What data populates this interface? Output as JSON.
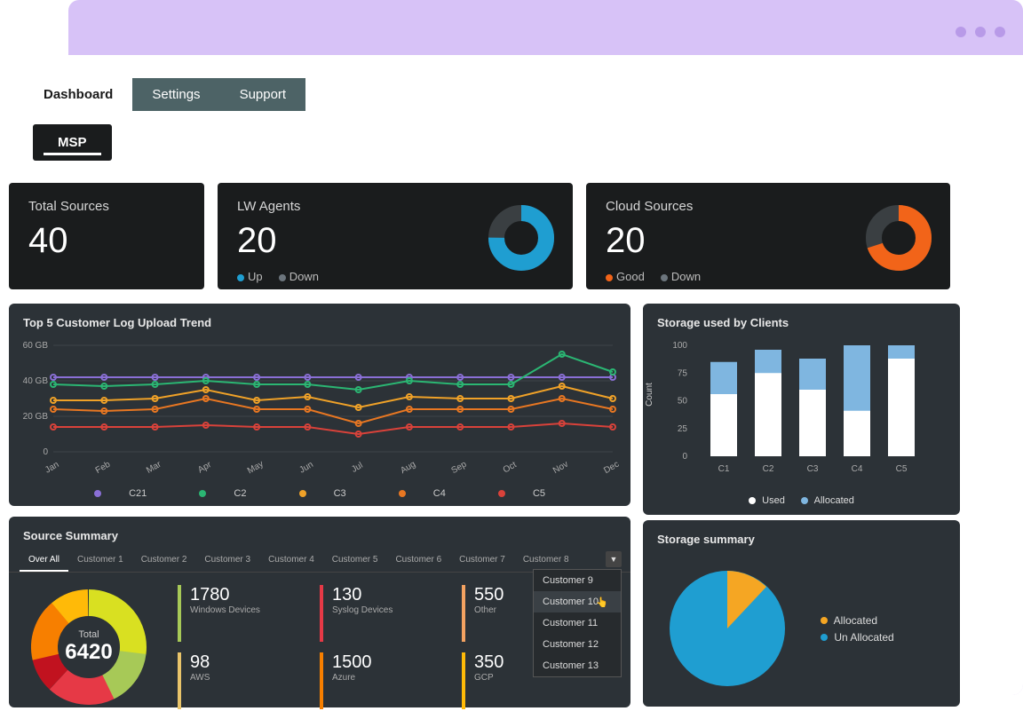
{
  "tabs": {
    "dashboard": "Dashboard",
    "settings": "Settings",
    "support": "Support"
  },
  "sub_tab": "MSP",
  "cards": {
    "total": {
      "title": "Total Sources",
      "value": "40"
    },
    "lw": {
      "title": "LW Agents",
      "value": "20",
      "legend_up": "Up",
      "legend_down": "Down"
    },
    "cloud": {
      "title": "Cloud Sources",
      "value": "20",
      "legend_good": "Good",
      "legend_down": "Down"
    }
  },
  "trend": {
    "title": "Top 5 Customer Log Upload Trend",
    "legend": [
      "C21",
      "C2",
      "C3",
      "C4",
      "C5"
    ]
  },
  "storage_clients": {
    "title": "Storage used by Clients",
    "ylabel": "Count",
    "legend_used": "Used",
    "legend_alloc": "Allocated"
  },
  "summary": {
    "title": "Source Summary",
    "tabs": [
      "Over All",
      "Customer 1",
      "Customer 2",
      "Customer 3",
      "Customer 4",
      "Customer 5",
      "Customer 6",
      "Customer 7",
      "Customer 8"
    ],
    "dropdown": [
      "Customer 9",
      "Customer 10",
      "Customer 11",
      "Customer 12",
      "Customer 13"
    ],
    "total_label": "Total",
    "total_value": "6420",
    "stats": [
      {
        "value": "1780",
        "label": "Windows Devices",
        "color": "#a7c957"
      },
      {
        "value": "130",
        "label": "Syslog Devices",
        "color": "#e63946"
      },
      {
        "value": "550",
        "label": "Other",
        "color": "#f4a261"
      },
      {
        "value": "98",
        "label": "AWS",
        "color": "#e9c46a"
      },
      {
        "value": "1500",
        "label": "Azure",
        "color": "#f77f00"
      },
      {
        "value": "350",
        "label": "GCP",
        "color": "#ffba08"
      }
    ]
  },
  "storage_summary": {
    "title": "Storage summary",
    "legend_alloc": "Allocated",
    "legend_unalloc": "Un Allocated"
  },
  "chart_data": [
    {
      "type": "donut",
      "name": "lw_agents",
      "series": [
        {
          "name": "Up",
          "value": 75,
          "color": "#1f9ed1"
        },
        {
          "name": "Down",
          "value": 25,
          "color": "#3a3f42"
        }
      ]
    },
    {
      "type": "donut",
      "name": "cloud_sources",
      "series": [
        {
          "name": "Good",
          "value": 70,
          "color": "#f26419"
        },
        {
          "name": "Down",
          "value": 30,
          "color": "#3a3f42"
        }
      ]
    },
    {
      "type": "line",
      "name": "log_upload_trend",
      "title": "Top 5 Customer Log Upload Trend",
      "xlabel": "",
      "ylabel": "GB",
      "x": [
        "Jan",
        "Feb",
        "Mar",
        "Apr",
        "May",
        "Jun",
        "Jul",
        "Aug",
        "Sep",
        "Oct",
        "Nov",
        "Dec"
      ],
      "yticks": [
        0,
        20,
        40,
        60
      ],
      "yticklabels": [
        "0",
        "20 GB",
        "40 GB",
        "60 GB"
      ],
      "series": [
        {
          "name": "C21",
          "color": "#8a6fd6",
          "values": [
            42,
            42,
            42,
            42,
            42,
            42,
            42,
            42,
            42,
            42,
            42,
            42
          ]
        },
        {
          "name": "C2",
          "color": "#2bb673",
          "values": [
            38,
            37,
            38,
            40,
            38,
            38,
            35,
            40,
            38,
            38,
            55,
            45
          ]
        },
        {
          "name": "C3",
          "color": "#f0a228",
          "values": [
            29,
            29,
            30,
            35,
            29,
            31,
            25,
            31,
            30,
            30,
            37,
            30
          ]
        },
        {
          "name": "C4",
          "color": "#e87722",
          "values": [
            24,
            23,
            24,
            30,
            24,
            24,
            16,
            24,
            24,
            24,
            30,
            24
          ]
        },
        {
          "name": "C5",
          "color": "#d9423a",
          "values": [
            14,
            14,
            14,
            15,
            14,
            14,
            10,
            14,
            14,
            14,
            16,
            14
          ]
        }
      ]
    },
    {
      "type": "bar",
      "name": "storage_used_by_clients",
      "title": "Storage used by Clients",
      "ylabel": "Count",
      "ylim": [
        0,
        100
      ],
      "yticks": [
        0,
        25,
        50,
        75,
        100
      ],
      "categories": [
        "C1",
        "C2",
        "C3",
        "C4",
        "C5"
      ],
      "series": [
        {
          "name": "Used",
          "color": "#ffffff",
          "values": [
            56,
            75,
            60,
            41,
            88
          ]
        },
        {
          "name": "Allocated",
          "color": "#7fb6e0",
          "values": [
            85,
            96,
            88,
            100,
            100
          ]
        }
      ]
    },
    {
      "type": "donut",
      "name": "source_summary_total",
      "total": 6420,
      "series": [
        {
          "name": "Windows Devices",
          "value": 1780,
          "color": "#a7c957"
        },
        {
          "name": "Syslog Devices",
          "value": 130,
          "color": "#e63946"
        },
        {
          "name": "Other",
          "value": 550,
          "color": "#f4a261"
        },
        {
          "name": "AWS",
          "value": 98,
          "color": "#e9c46a"
        },
        {
          "name": "Azure",
          "value": 1500,
          "color": "#f77f00"
        },
        {
          "name": "GCP",
          "value": 350,
          "color": "#ffba08"
        }
      ]
    },
    {
      "type": "pie",
      "name": "storage_summary",
      "series": [
        {
          "name": "Allocated",
          "value": 12,
          "color": "#f5a623"
        },
        {
          "name": "Un Allocated",
          "value": 88,
          "color": "#1f9ed1"
        }
      ]
    }
  ]
}
